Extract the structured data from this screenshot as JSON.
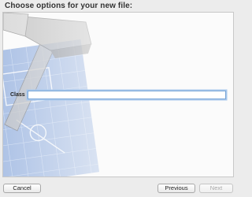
{
  "header": {
    "title": "Choose options for your new file:"
  },
  "form": {
    "class_label": "Class",
    "class_value": ""
  },
  "buttons": {
    "cancel": "Cancel",
    "previous": "Previous",
    "next": "Next"
  },
  "icons": {
    "background_art": "hammer-blueprint-icon"
  },
  "colors": {
    "focus_ring": "#7aa7d8",
    "blueprint": "#5d85c9"
  }
}
